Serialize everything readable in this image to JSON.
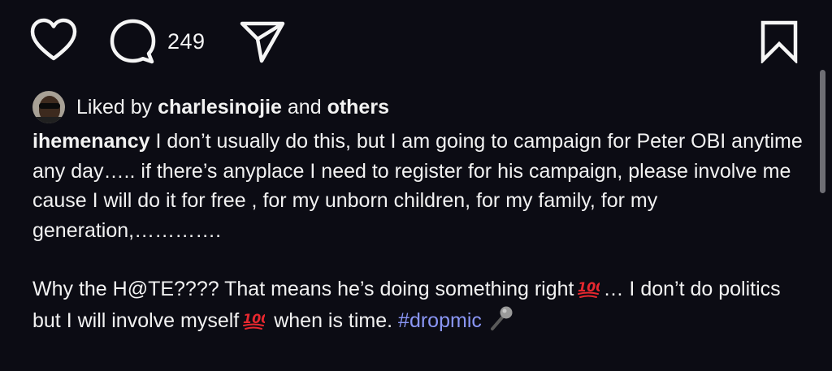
{
  "actions": {
    "like_icon": "heart-icon",
    "comment_icon": "comment-bubble-icon",
    "comment_count": "249",
    "share_icon": "paper-plane-icon",
    "save_icon": "bookmark-icon"
  },
  "likes": {
    "prefix": "Liked by",
    "user": "charlesinojie",
    "connector": "and",
    "others": "others"
  },
  "caption": {
    "username": "ihemenancy",
    "paragraph1": "I don’t usually do this, but I am going to campaign for Peter OBI anytime any day….. if there’s anyplace I need to register for his campaign, please involve me cause I will do it for free , for my unborn children, for my family, for my generation,………….",
    "paragraph2_part1": " Why the H@TE???? That means he’s doing something right",
    "paragraph2_part2": "… I don’t do politics but I will involve myself",
    "paragraph2_part3": "when is time.",
    "hashtag": "#dropmic"
  },
  "colors": {
    "background": "#0c0c14",
    "text": "#f2f2f2",
    "hashtag": "#8a96f5",
    "emoji_100": "#e8282f"
  }
}
